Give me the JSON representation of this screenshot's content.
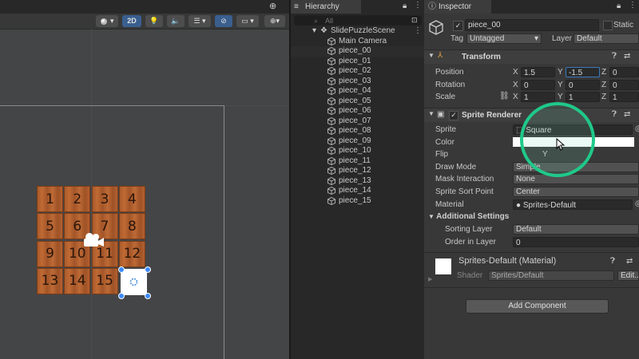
{
  "scene": {
    "toolbar": {
      "mode_2d": "2D"
    },
    "tiles": [
      "1",
      "2",
      "3",
      "4",
      "5",
      "6",
      "7",
      "8",
      "9",
      "10",
      "11",
      "12",
      "13",
      "14",
      "15"
    ]
  },
  "hierarchy": {
    "tab_label": "Hierarchy",
    "search_placeholder": "All",
    "scene_name": "SlidePuzzleScene",
    "items": [
      "Main Camera",
      "piece_00",
      "piece_01",
      "piece_02",
      "piece_03",
      "piece_04",
      "piece_05",
      "piece_06",
      "piece_07",
      "piece_08",
      "piece_09",
      "piece_10",
      "piece_11",
      "piece_12",
      "piece_13",
      "piece_14",
      "piece_15"
    ],
    "selected": "piece_00"
  },
  "inspector": {
    "tab_label": "Inspector",
    "object_name": "piece_00",
    "static_label": "Static",
    "tag_label": "Tag",
    "tag_value": "Untagged",
    "layer_label": "Layer",
    "layer_value": "Default",
    "transform": {
      "title": "Transform",
      "position_label": "Position",
      "rotation_label": "Rotation",
      "scale_label": "Scale",
      "position": {
        "x": "1.5",
        "y": "-1.5",
        "z": "0"
      },
      "rotation": {
        "x": "0",
        "y": "0",
        "z": "0"
      },
      "scale": {
        "x": "1",
        "y": "1",
        "z": "1"
      }
    },
    "sprite_renderer": {
      "title": "Sprite Renderer",
      "sprite_label": "Sprite",
      "sprite_value": "Square",
      "color_label": "Color",
      "flip_label": "Flip",
      "flip_y": "Y",
      "draw_mode_label": "Draw Mode",
      "draw_mode_value": "Simple",
      "mask_label": "Mask Interaction",
      "mask_value": "None",
      "sort_point_label": "Sprite Sort Point",
      "sort_point_value": "Center",
      "material_label": "Material",
      "material_value": "Sprites-Default",
      "additional_label": "Additional Settings",
      "sorting_layer_label": "Sorting Layer",
      "sorting_layer_value": "Default",
      "order_label": "Order in Layer",
      "order_value": "0"
    },
    "material": {
      "title": "Sprites-Default (Material)",
      "shader_label": "Shader",
      "shader_value": "Sprites/Default",
      "edit_label": "Edit..."
    },
    "add_component": "Add Component"
  }
}
